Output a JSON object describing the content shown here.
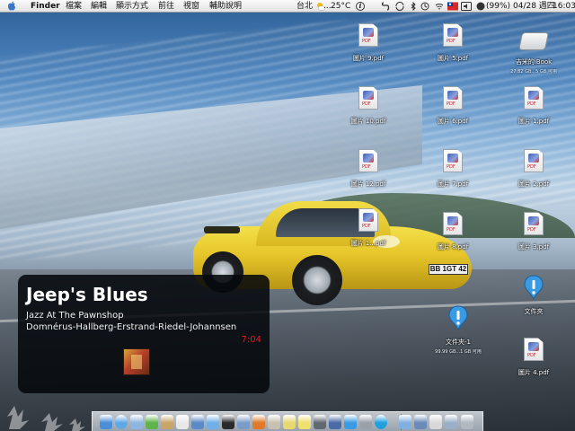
{
  "menubar": {
    "app_name": "Finder",
    "menus": [
      "檔案",
      "編輯",
      "顯示方式",
      "前往",
      "視窗",
      "輔助說明"
    ],
    "weather": {
      "city": "台北",
      "separator": "...",
      "temperature": "25°C"
    },
    "battery": "(99%)",
    "date": "04/28 週四",
    "time": "16:03"
  },
  "desktop": {
    "icons": [
      {
        "label": "圖片 9.pdf",
        "type": "pdf"
      },
      {
        "label": "圖片 5.pdf",
        "type": "pdf"
      },
      {
        "label": "吉米的iBook",
        "sub": "27.82 GB...5 GB 可用",
        "type": "disk"
      },
      {
        "label": "圖片 10.pdf",
        "type": "pdf"
      },
      {
        "label": "圖片 6.pdf",
        "type": "pdf"
      },
      {
        "label": "圖片 1.pdf",
        "type": "pdf"
      },
      {
        "label": "圖片 12.pdf",
        "type": "pdf"
      },
      {
        "label": "圖片 7.pdf",
        "type": "pdf"
      },
      {
        "label": "圖片 2.pdf",
        "type": "pdf"
      },
      {
        "label": "圖片 1...pdf",
        "type": "pdf"
      },
      {
        "label": "圖片 8.pdf",
        "type": "pdf"
      },
      {
        "label": "圖片 3.pdf",
        "type": "pdf"
      },
      {
        "label": "文件夾",
        "type": "dropbox"
      },
      {
        "label": "文件夾-1",
        "sub": "99.99 GB...1 GB 可用",
        "type": "dropbox"
      },
      {
        "label": "圖片 4.pdf",
        "type": "pdf"
      }
    ]
  },
  "now_playing": {
    "title": "Jeep's Blues",
    "album": "Jazz At The Pawnshop",
    "artist": "Domnérus-Hallberg-Erstrand-Riedel-Johannsen",
    "time": "7:04"
  },
  "wallpaper": {
    "plate": "BB 1GT 42"
  },
  "dock": {
    "items": [
      "finder-icon",
      "safari-icon",
      "mail-icon",
      "ichat-icon",
      "address-book-icon",
      "calendar-icon",
      "iphoto-icon",
      "itunes-icon",
      "terminal-icon",
      "preview-icon",
      "firefox-icon",
      "contact-icon",
      "notes-icon",
      "stickies-icon",
      "camera-icon",
      "sync-icon",
      "chat-icon",
      "system-prefs-icon",
      "skype-icon",
      "folder-icon",
      "download-icon",
      "app-icon",
      "monitor-icon",
      "trash-icon"
    ]
  },
  "colors": {
    "time_accent": "#e21c1c",
    "menubar_bg": "#eeeeee"
  }
}
